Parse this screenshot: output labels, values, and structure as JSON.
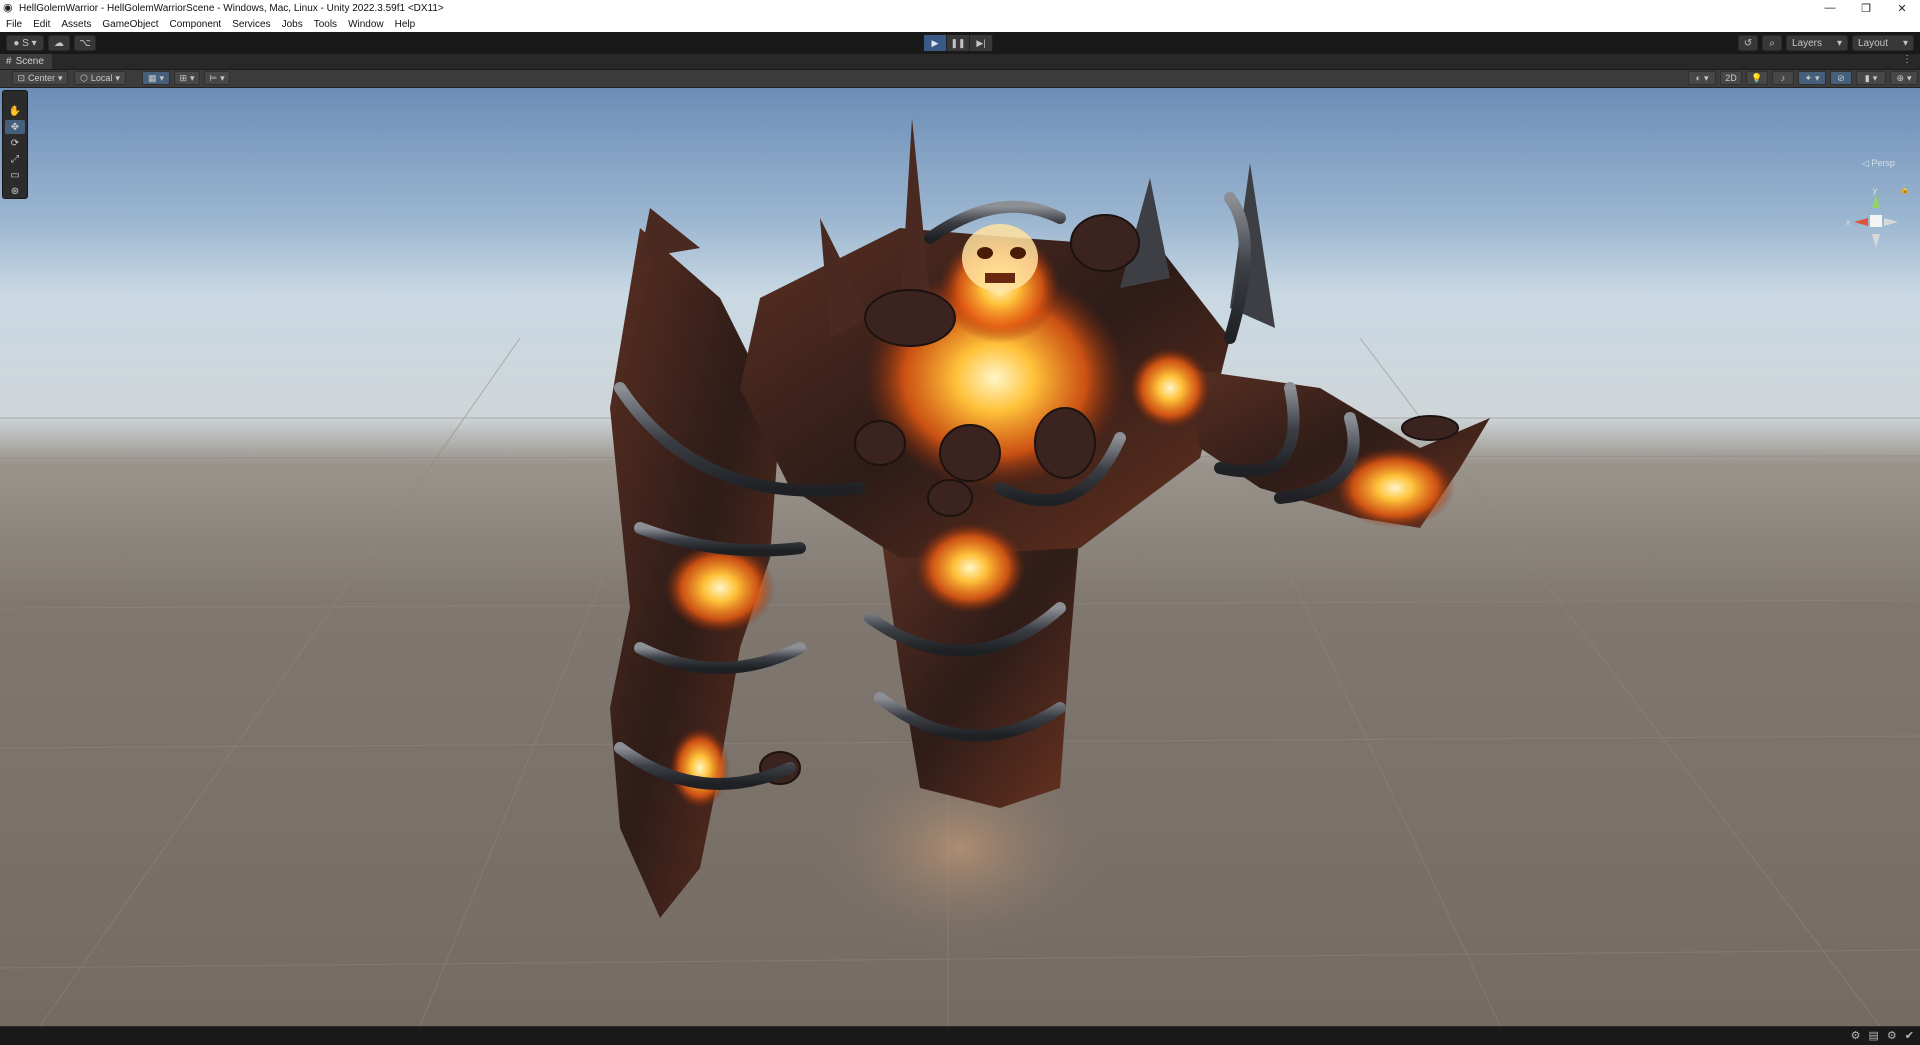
{
  "window": {
    "title": "HellGolemWarrior - HellGolemWarriorScene - Windows, Mac, Linux - Unity 2022.3.59f1 <DX11>",
    "controls": {
      "minimize": "—",
      "maximize": "❐",
      "close": "✕"
    }
  },
  "menu": [
    "File",
    "Edit",
    "Assets",
    "GameObject",
    "Component",
    "Services",
    "Jobs",
    "Tools",
    "Window",
    "Help"
  ],
  "toolbar": {
    "account_label": "S",
    "play_icons": [
      "play-icon",
      "pause-icon",
      "step-icon"
    ],
    "layers_label": "Layers",
    "layout_label": "Layout"
  },
  "scene_tab": {
    "label": "Scene"
  },
  "scene_toolbar": {
    "pivot_label": "Center",
    "space_label": "Local",
    "mode_2d_label": "2D"
  },
  "tools": [
    "hand-tool-icon",
    "move-tool-icon",
    "rotate-tool-icon",
    "scale-tool-icon",
    "rect-tool-icon",
    "transform-tool-icon"
  ],
  "gizmo": {
    "x_label": "x",
    "y_label": "y",
    "persp_label": "◁ Persp"
  },
  "colors": {
    "play_active": "#3a5a85",
    "editor_dark": "#191919",
    "panel": "#3c3c3c",
    "lava": "#ff8a1e",
    "rock": "#3a2a26"
  }
}
